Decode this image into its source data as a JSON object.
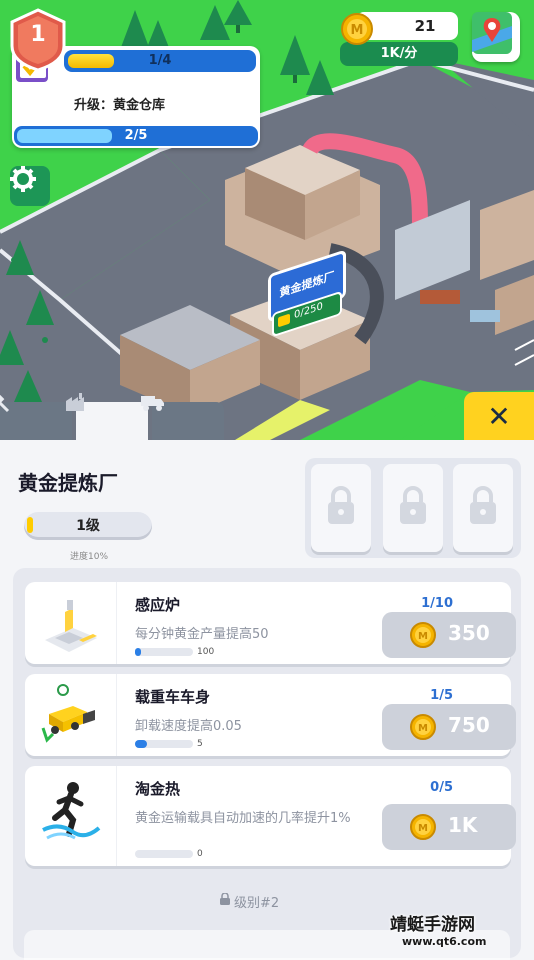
{
  "hud": {
    "level": "1",
    "quest_progress_text": "1/4",
    "quest_progress_fraction": 0.25,
    "quest_label": "升级：黄金仓库",
    "quest_sub_progress_text": "2/5",
    "quest_sub_progress_fraction": 0.4,
    "coins": "21",
    "rate": "1K/分"
  },
  "scene": {
    "building_sign": "黄金提炼厂",
    "building_capacity": "0/250"
  },
  "tabs": [
    {
      "icon": "hammer-icon",
      "active": false
    },
    {
      "icon": "factory-icon",
      "active": true
    },
    {
      "icon": "truck-icon",
      "active": false
    }
  ],
  "panel": {
    "title": "黄金提炼厂",
    "level_label": "1级",
    "level_progress_fraction": 0.1,
    "progress_note": "进度10%",
    "locked_slots": 3,
    "upgrades": [
      {
        "name": "感应炉",
        "desc": "每分钟黄金产量提高50",
        "count": "1/10",
        "bar_fraction": 0.1,
        "bar_label": "100",
        "cost": "350",
        "icon": "induction-furnace-icon"
      },
      {
        "name": "载重车车身",
        "desc": "卸载速度提高0.05",
        "count": "1/5",
        "bar_fraction": 0.2,
        "bar_label": "5",
        "cost": "750",
        "icon": "dump-truck-icon"
      },
      {
        "name": "淘金热",
        "desc": "黄金运输载具自动加速的几率提升1%",
        "count": "0/5",
        "bar_fraction": 0.0,
        "bar_label": "0",
        "cost": "1K",
        "icon": "running-man-icon"
      }
    ],
    "next_level_label": "级别#2"
  },
  "watermark": {
    "line1": "靖蜓手游网",
    "line2": "www.qt6.com"
  },
  "colors": {
    "grass": "#3fd24a",
    "road": "#6d7482",
    "accent_blue": "#1f6fd6",
    "accent_yellow": "#ffd21f",
    "card_button": "#cdd1da"
  }
}
